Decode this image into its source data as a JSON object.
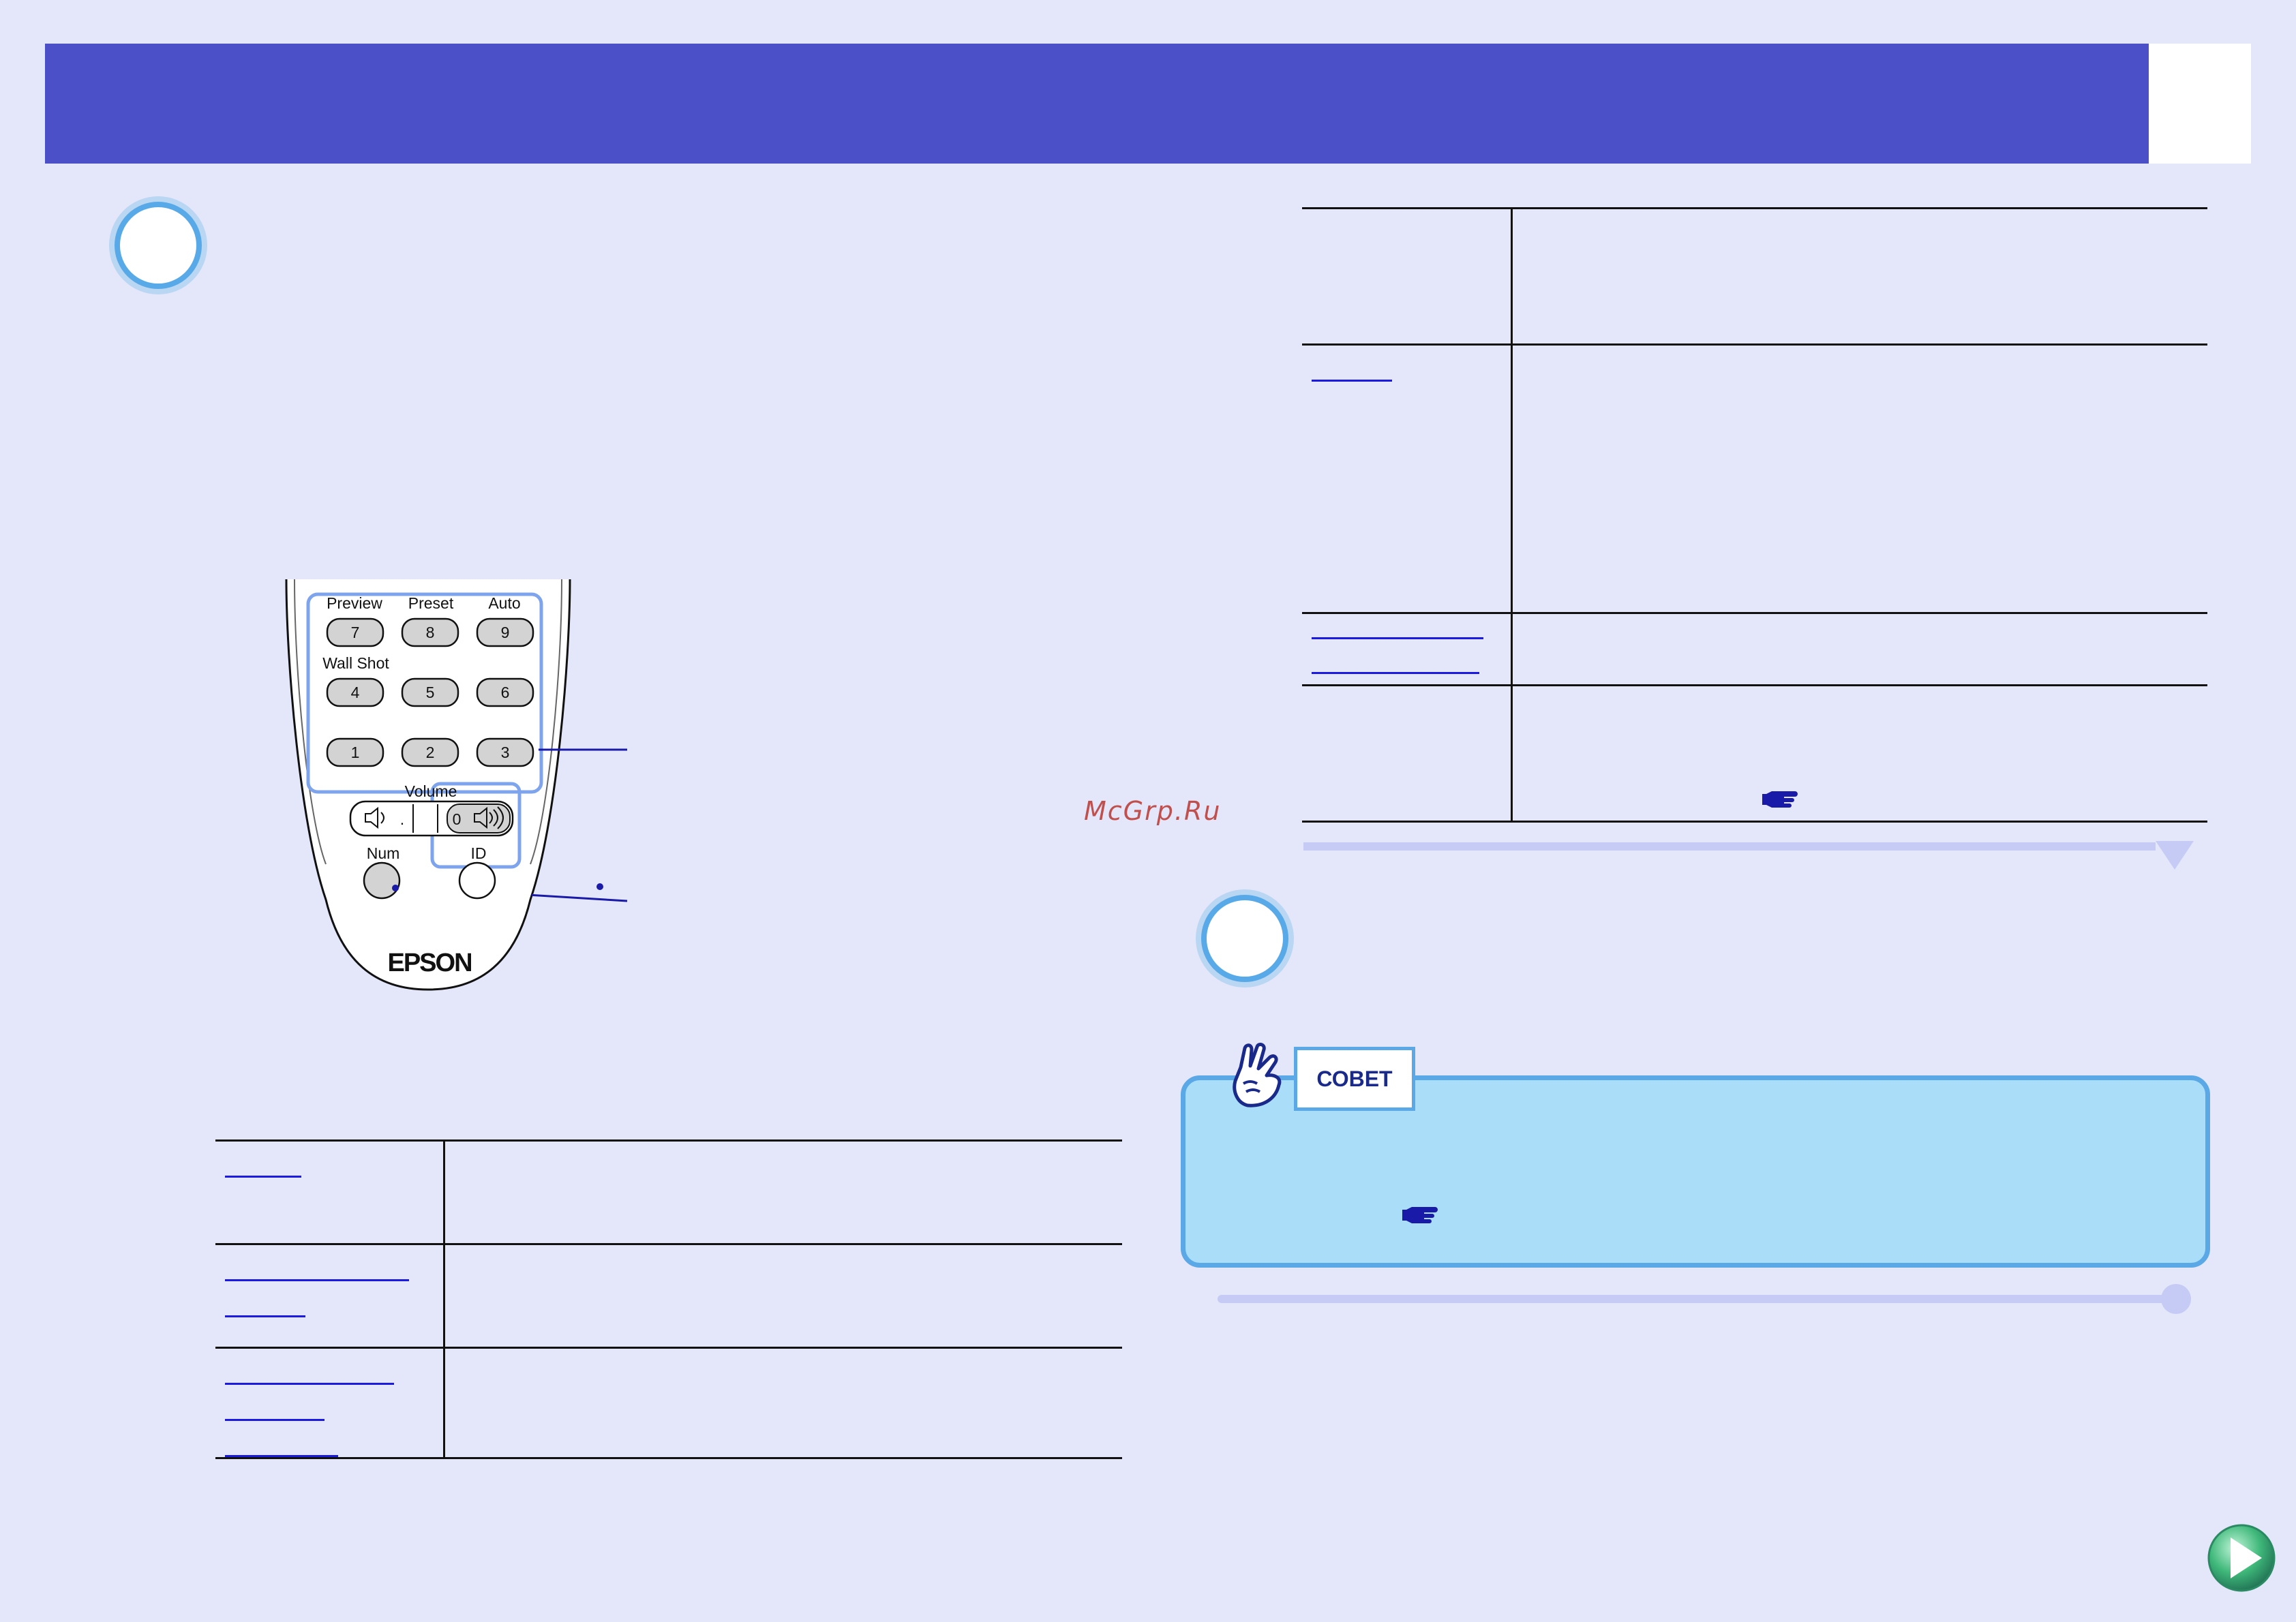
{
  "header": {
    "title": ""
  },
  "remote": {
    "row1_labels": [
      "Preview",
      "Preset",
      "Auto"
    ],
    "row1_keys": [
      "7",
      "8",
      "9"
    ],
    "row2_label": "Wall Shot",
    "row2_keys": [
      "4",
      "5",
      "6"
    ],
    "row3_keys": [
      "1",
      "2",
      "3"
    ],
    "volume_label": "Volume",
    "volume_dot": ".",
    "volume_zero": "0",
    "num_label": "Num",
    "id_label": "ID",
    "brand": "EPSON"
  },
  "watermark": "McGrp.Ru",
  "tip": {
    "label": "СОВЕТ"
  },
  "colors": {
    "header": "#4b4fc8",
    "background": "#e4e6fa",
    "tip_fill": "#a9ddf8",
    "tip_border": "#5aa8e6",
    "link": "#1a1ae0",
    "watermark": "#c0504d"
  },
  "icons": {
    "pointer": "pointing-hand-icon",
    "tip": "thumbs-up-hand-icon",
    "next": "next-page-arrow-icon"
  }
}
